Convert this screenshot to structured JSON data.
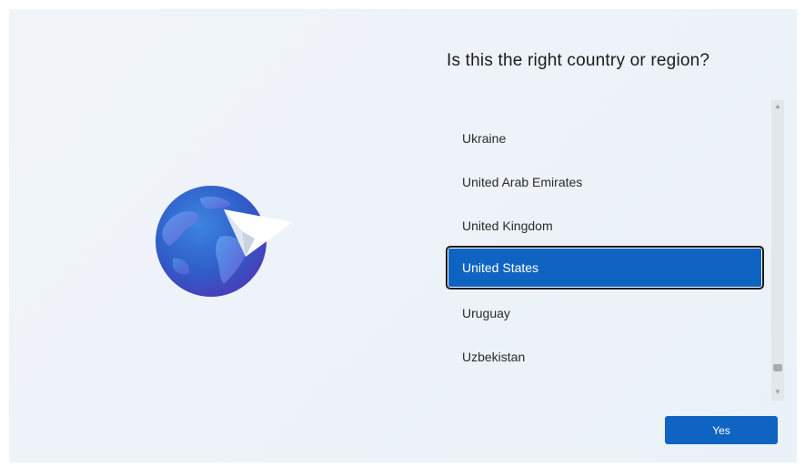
{
  "page": {
    "title": "Is this the right country or region?"
  },
  "country_list": {
    "items": [
      {
        "label": "Ukraine",
        "selected": false
      },
      {
        "label": "United Arab Emirates",
        "selected": false
      },
      {
        "label": "United Kingdom",
        "selected": false
      },
      {
        "label": "United States",
        "selected": true
      },
      {
        "label": "Uruguay",
        "selected": false
      },
      {
        "label": "Uzbekistan",
        "selected": false
      }
    ]
  },
  "actions": {
    "yes_label": "Yes"
  },
  "icons": {
    "illustration": "globe-paper-plane-icon",
    "scroll_up": "chevron-up-icon",
    "scroll_down": "chevron-down-icon"
  },
  "colors": {
    "accent": "#0f64c2",
    "background": "#eef3f9",
    "text": "#1b1b1b"
  }
}
